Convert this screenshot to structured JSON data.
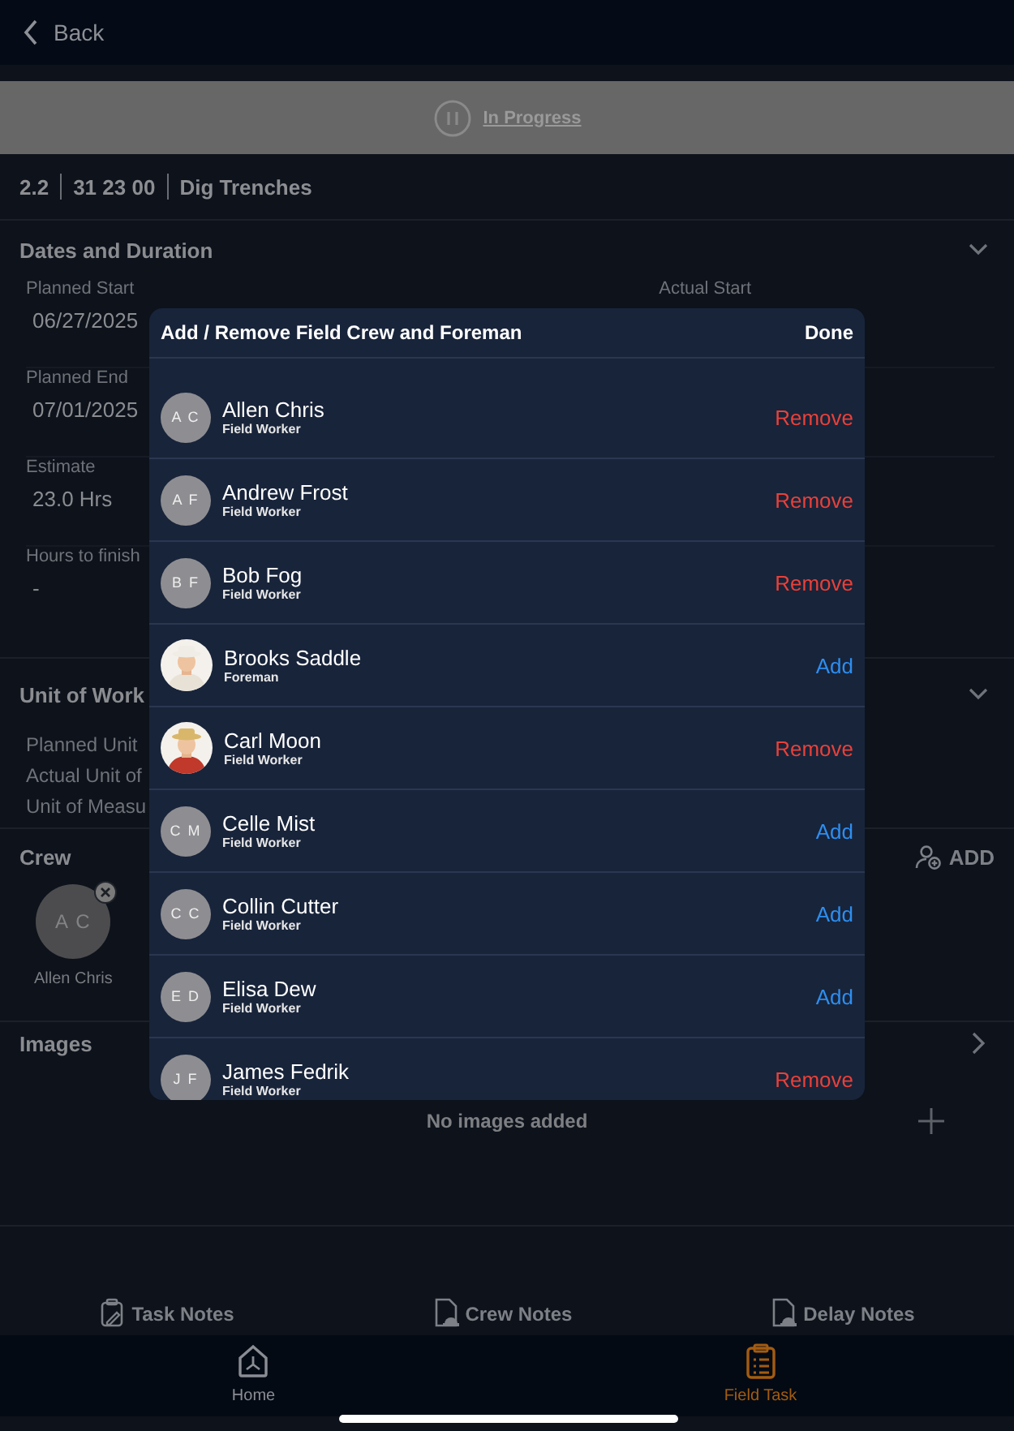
{
  "nav": {
    "back": "Back"
  },
  "status": {
    "label": "In Progress"
  },
  "task": {
    "number": "2.2",
    "code": "31 23 00",
    "name": "Dig Trenches"
  },
  "dates": {
    "title": "Dates and Duration",
    "expanded": true,
    "actual_start_label": "Actual Start",
    "fields": [
      {
        "label": "Planned Start",
        "value": "06/27/2025"
      },
      {
        "label": "Planned End",
        "value": "07/01/2025"
      },
      {
        "label": "Estimate",
        "value": "23.0 Hrs"
      },
      {
        "label": "Hours to finish",
        "value": "-"
      }
    ]
  },
  "unit_of_work": {
    "title": "Unit of Work",
    "expanded": true,
    "labels": [
      "Planned Unit",
      "Actual Unit of",
      "Unit of Measu"
    ]
  },
  "crew": {
    "title": "Crew",
    "add_label": "ADD",
    "members": [
      {
        "initials": "A C",
        "name": "Allen Chris"
      }
    ]
  },
  "images": {
    "title": "Images",
    "expanded": false,
    "empty_text": "No images added"
  },
  "notes": [
    {
      "label": "Task Notes",
      "kind": "task"
    },
    {
      "label": "Crew Notes",
      "kind": "crew"
    },
    {
      "label": "Delay Notes",
      "kind": "delay"
    }
  ],
  "tabs": [
    {
      "label": "Home",
      "kind": "home",
      "selected": false
    },
    {
      "label": "Field Task",
      "kind": "task",
      "selected": true
    }
  ],
  "dialog": {
    "title": "Add / Remove Field Crew and Foreman",
    "done": "Done",
    "people": [
      {
        "kind": "initials",
        "initials": "A C",
        "name": "Allen Chris",
        "role": "Field Worker",
        "action": {
          "label": "Remove",
          "kind": "remove"
        }
      },
      {
        "kind": "initials",
        "initials": "A F",
        "name": "Andrew Frost",
        "role": "Field Worker",
        "action": {
          "label": "Remove",
          "kind": "remove"
        }
      },
      {
        "kind": "initials",
        "initials": "B F",
        "name": "Bob Fog",
        "role": "Field Worker",
        "action": {
          "label": "Remove",
          "kind": "remove"
        }
      },
      {
        "name": "Brooks Saddle",
        "role": "Foreman",
        "action": {
          "label": "Add",
          "kind": "add"
        }
      },
      {
        "name": "Carl Moon",
        "role": "Field Worker",
        "action": {
          "label": "Remove",
          "kind": "remove"
        }
      },
      {
        "kind": "initials",
        "initials": "C M",
        "name": "Celle Mist",
        "role": "Field Worker",
        "action": {
          "label": "Add",
          "kind": "add"
        }
      },
      {
        "kind": "initials",
        "initials": "C C",
        "name": "Collin Cutter",
        "role": "Field Worker",
        "action": {
          "label": "Add",
          "kind": "add"
        }
      },
      {
        "kind": "initials",
        "initials": "E D",
        "name": "Elisa Dew",
        "role": "Field Worker",
        "action": {
          "label": "Add",
          "kind": "add"
        }
      },
      {
        "kind": "initials",
        "initials": "J F",
        "name": "James Fedrik",
        "role": "Field Worker",
        "action": {
          "label": "Remove",
          "kind": "remove"
        }
      }
    ]
  }
}
